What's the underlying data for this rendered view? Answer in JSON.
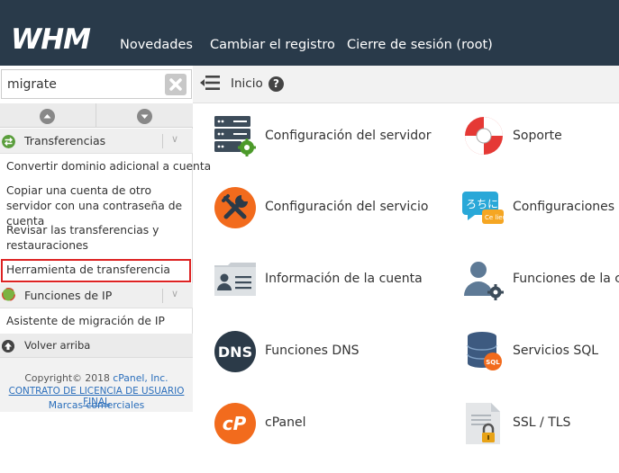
{
  "header": {
    "logo": "WHM",
    "nav": [
      "Novedades",
      "Cambiar el registro",
      "Cierre de sesión (root)"
    ]
  },
  "search": {
    "value": "migrate"
  },
  "breadcrumb": {
    "home": "Inicio"
  },
  "sidebar": {
    "categories": [
      {
        "label": "Transferencias",
        "items": [
          "Convertir dominio adicional a cuenta",
          "Copiar una cuenta de otro servidor con una contraseña de cuenta",
          "Revisar las transferencias y restauraciones",
          "Herramienta de transferencia"
        ]
      },
      {
        "label": "Funciones de IP",
        "items": [
          "Asistente de migración de IP"
        ]
      }
    ],
    "back_to_top": "Volver arriba",
    "footer": {
      "copyright_prefix": "Copyright© 2018 ",
      "copyright_brand": "cPanel, Inc.",
      "license": "CONTRATO DE LICENCIA DE USUARIO FINAL",
      "trademarks": "Marcas comerciales"
    }
  },
  "tiles": [
    "Configuración del servidor",
    "Soporte",
    "Configuración del servicio",
    "Configuraciones re",
    "Información de la cuenta",
    "Funciones de la cu",
    "Funciones DNS",
    "Servicios SQL",
    "cPanel",
    "SSL / TLS"
  ],
  "icons": {
    "dns_text": "DNS",
    "sql_text": "SQL",
    "locale_text": "ろちに",
    "locale_sub": "Ce lieu",
    "cpanel_text": "cP"
  },
  "colors": {
    "header_bg": "#293a4a",
    "orange": "#f26b1d",
    "dark_blue": "#293a4a",
    "link_blue": "#2a6ebb",
    "highlight_red": "#dd2222"
  }
}
